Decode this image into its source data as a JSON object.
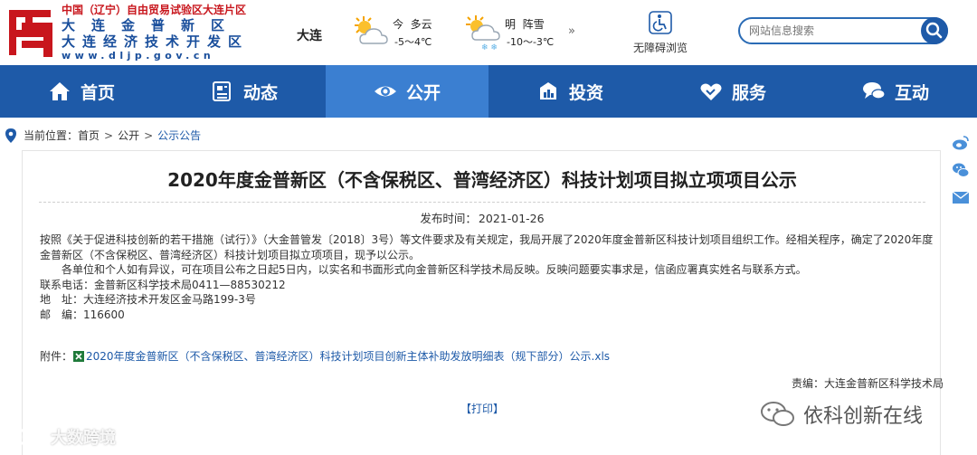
{
  "header": {
    "logo_line1": "中国（辽宁）自由贸易试验区大连片区",
    "logo_line2": "大连金普新区",
    "logo_line3": "大连经济技术开发区",
    "logo_line4": "www.dljp.gov.cn",
    "city": "大连",
    "weather": [
      {
        "day": "今",
        "condition": "多云",
        "temp": "-5～4℃",
        "icon": "sun-cloud-icon"
      },
      {
        "day": "明",
        "condition": "阵雪",
        "temp": "-10～-3℃",
        "icon": "snow-shower-icon"
      }
    ],
    "weather_more": "»",
    "accessibility_label": "无障碍浏览",
    "search_placeholder": "网站信息搜索"
  },
  "nav": {
    "items": [
      {
        "label": "首页",
        "icon": "home-icon",
        "active": false
      },
      {
        "label": "动态",
        "icon": "news-icon",
        "active": false
      },
      {
        "label": "公开",
        "icon": "eye-icon",
        "active": true
      },
      {
        "label": "投资",
        "icon": "chart-icon",
        "active": false
      },
      {
        "label": "服务",
        "icon": "handshake-icon",
        "active": false
      },
      {
        "label": "互动",
        "icon": "chat-icon",
        "active": false
      }
    ]
  },
  "breadcrumb": {
    "prefix": "当前位置：",
    "items": [
      "首页",
      "公开",
      "公示公告"
    ],
    "separator": ">"
  },
  "article": {
    "title": "2020年度金普新区（不含保税区、普湾经济区）科技计划项目拟立项项目公示",
    "publish_label": "发布时间：",
    "publish_date": "2021-01-26",
    "para1": "按照《关于促进科技创新的若干措施（试行）》（大金普管发〔2018〕3号）等文件要求及有关规定，我局开展了2020年度金普新区科技计划项目组织工作。经相关程序，确定了2020年度金普新区（不含保税区、普湾经济区）科技计划项目拟立项项目，现予以公示。",
    "para2": "各单位和个人如有异议，可在项目公布之日起5日内，以实名和书面形式向金普新区科学技术局反映。反映问题要实事求是，信函应署真实姓名与联系方式。",
    "contact_phone": "联系电话：金普新区科学技术局0411—88530212",
    "address": "地　址：大连经济技术开发区金马路199-3号",
    "postcode": "邮　编：116600",
    "attachment_label": "附件：",
    "attachment_name": "2020年度金普新区（不含保税区、普湾经济区）科技计划项目创新主体补助发放明细表（规下部分）公示.xls",
    "editor": "责编：大连金普新区科学技术局",
    "print_label": "【打印】"
  },
  "watermark": {
    "left": "大数跨境",
    "right": "依科创新在线"
  },
  "colors": {
    "nav_bg": "#1e5aa8",
    "nav_active": "#3b7fd1",
    "logo_red": "#c8161d",
    "link": "#1e5aa8"
  }
}
